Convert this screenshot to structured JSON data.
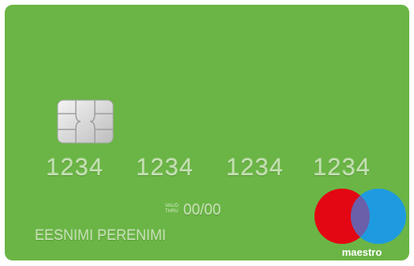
{
  "card": {
    "background_color": "#6ab545",
    "number_groups": [
      "1234",
      "1234",
      "1234",
      "1234"
    ],
    "valid_label": "VALID\nTHRU",
    "expiry": "00/00",
    "holder_name": "EESNIMI PERENIMI",
    "chip_icon": "emv-chip-icon",
    "brand": {
      "icon": "maestro-logo-icon",
      "wordmark": "maestro",
      "left_circle_color": "#e30613",
      "right_circle_color": "#1e9be0",
      "overlap_color": "#6b5fa9"
    }
  }
}
